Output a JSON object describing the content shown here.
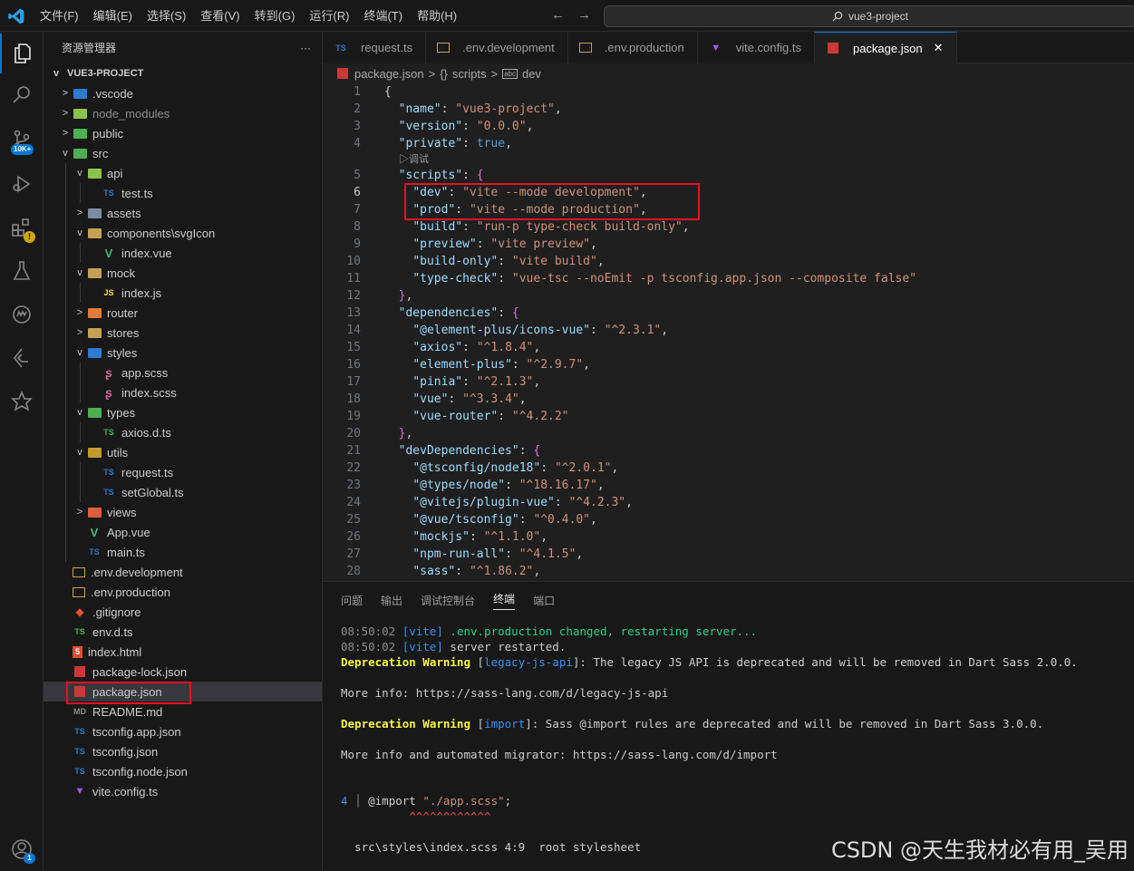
{
  "menu": [
    "文件(F)",
    "编辑(E)",
    "选择(S)",
    "查看(V)",
    "转到(G)",
    "运行(R)",
    "终端(T)",
    "帮助(H)"
  ],
  "command_center": "vue3-project",
  "activity": {
    "scm_badge": "10K+"
  },
  "explorer": {
    "title": "资源管理器",
    "more": "···",
    "project": "VUE3-PROJECT",
    "items": [
      {
        "label": ".vscode",
        "depth": 0,
        "chev": ">",
        "icon": "folder",
        "color": "#2f7ad2"
      },
      {
        "label": "node_modules",
        "depth": 0,
        "chev": ">",
        "icon": "folder",
        "color": "#8bc34a",
        "dim": true
      },
      {
        "label": "public",
        "depth": 0,
        "chev": ">",
        "icon": "folder",
        "color": "#4caf50"
      },
      {
        "label": "src",
        "depth": 0,
        "chev": "v",
        "icon": "folder",
        "color": "#4caf50"
      },
      {
        "label": "api",
        "depth": 1,
        "chev": "v",
        "icon": "folder",
        "color": "#8bc34a"
      },
      {
        "label": "test.ts",
        "depth": 2,
        "chev": "",
        "icon": "TS",
        "color": "#3178c6"
      },
      {
        "label": "assets",
        "depth": 1,
        "chev": ">",
        "icon": "folder",
        "color": "#7e8aa0"
      },
      {
        "label": "components\\svgIcon",
        "depth": 1,
        "chev": "v",
        "icon": "folder",
        "color": "#c5a155"
      },
      {
        "label": "index.vue",
        "depth": 2,
        "chev": "",
        "icon": "V",
        "color": "#41b883"
      },
      {
        "label": "mock",
        "depth": 1,
        "chev": "v",
        "icon": "folder",
        "color": "#c5a155"
      },
      {
        "label": "index.js",
        "depth": 2,
        "chev": "",
        "icon": "JS",
        "color": "#f1dd35"
      },
      {
        "label": "router",
        "depth": 1,
        "chev": ">",
        "icon": "folder",
        "color": "#e07b39"
      },
      {
        "label": "stores",
        "depth": 1,
        "chev": ">",
        "icon": "folder",
        "color": "#c5a155"
      },
      {
        "label": "styles",
        "depth": 1,
        "chev": "v",
        "icon": "folder",
        "color": "#2f7ad2"
      },
      {
        "label": "app.scss",
        "depth": 2,
        "chev": "",
        "icon": "S",
        "color": "#cd6799"
      },
      {
        "label": "index.scss",
        "depth": 2,
        "chev": "",
        "icon": "S",
        "color": "#cd6799"
      },
      {
        "label": "types",
        "depth": 1,
        "chev": "v",
        "icon": "folder",
        "color": "#4caf50"
      },
      {
        "label": "axios.d.ts",
        "depth": 2,
        "chev": "",
        "icon": "TS",
        "color": "#4caf50"
      },
      {
        "label": "utils",
        "depth": 1,
        "chev": "v",
        "icon": "folder",
        "color": "#c59a2c"
      },
      {
        "label": "request.ts",
        "depth": 2,
        "chev": "",
        "icon": "TS",
        "color": "#3178c6"
      },
      {
        "label": "setGlobal.ts",
        "depth": 2,
        "chev": "",
        "icon": "TS",
        "color": "#3178c6"
      },
      {
        "label": "views",
        "depth": 1,
        "chev": ">",
        "icon": "folder",
        "color": "#e05d3a"
      },
      {
        "label": "App.vue",
        "depth": 1,
        "chev": "",
        "icon": "V",
        "color": "#41b883"
      },
      {
        "label": "main.ts",
        "depth": 1,
        "chev": "",
        "icon": "TS",
        "color": "#3178c6"
      },
      {
        "label": ".env.development",
        "depth": 0,
        "chev": "",
        "icon": "env",
        "color": "#c5a155"
      },
      {
        "label": ".env.production",
        "depth": 0,
        "chev": "",
        "icon": "env",
        "color": "#c5a155"
      },
      {
        "label": ".gitignore",
        "depth": 0,
        "chev": "",
        "icon": "git",
        "color": "#e94e32"
      },
      {
        "label": "env.d.ts",
        "depth": 0,
        "chev": "",
        "icon": "TS",
        "color": "#4caf50"
      },
      {
        "label": "index.html",
        "depth": 0,
        "chev": "",
        "icon": "5",
        "color": "#e44d26"
      },
      {
        "label": "package-lock.json",
        "depth": 0,
        "chev": "",
        "icon": "npm",
        "color": "#cb3837"
      },
      {
        "label": "package.json",
        "depth": 0,
        "chev": "",
        "icon": "npm",
        "color": "#cb3837",
        "selected": true
      },
      {
        "label": "README.md",
        "depth": 0,
        "chev": "",
        "icon": "MD",
        "color": "#8a8a8a"
      },
      {
        "label": "tsconfig.app.json",
        "depth": 0,
        "chev": "",
        "icon": "TS",
        "color": "#3178c6"
      },
      {
        "label": "tsconfig.json",
        "depth": 0,
        "chev": "",
        "icon": "TS",
        "color": "#3178c6"
      },
      {
        "label": "tsconfig.node.json",
        "depth": 0,
        "chev": "",
        "icon": "TS",
        "color": "#3178c6"
      },
      {
        "label": "vite.config.ts",
        "depth": 0,
        "chev": "",
        "icon": "vite",
        "color": "#a855f7"
      }
    ]
  },
  "tabs": [
    {
      "label": "request.ts",
      "icon": "TS",
      "color": "#3178c6"
    },
    {
      "label": ".env.development",
      "icon": "env",
      "color": "#c5a155"
    },
    {
      "label": ".env.production",
      "icon": "env",
      "color": "#c5a155"
    },
    {
      "label": "vite.config.ts",
      "icon": "vite",
      "color": "#a855f7"
    },
    {
      "label": "package.json",
      "icon": "npm",
      "color": "#cb3837",
      "active": true,
      "close": "✕"
    }
  ],
  "breadcrumb": {
    "file": "package.json",
    "sep": ">",
    "scripts_icon": "{}",
    "scripts": "scripts",
    "dev_icon": "abc",
    "dev": "dev"
  },
  "code": {
    "lens": "▷调试",
    "lines": [
      {
        "n": "1",
        "t": [
          [
            "w",
            "{"
          ]
        ]
      },
      {
        "n": "2",
        "t": [
          [
            "w",
            "  "
          ],
          [
            "k",
            "\"name\""
          ],
          [
            "w",
            ": "
          ],
          [
            "s",
            "\"vue3-project\""
          ],
          [
            "w",
            ","
          ]
        ]
      },
      {
        "n": "3",
        "t": [
          [
            "w",
            "  "
          ],
          [
            "k",
            "\"version\""
          ],
          [
            "w",
            ": "
          ],
          [
            "s",
            "\"0.0.0\""
          ],
          [
            "w",
            ","
          ]
        ]
      },
      {
        "n": "4",
        "t": [
          [
            "w",
            "  "
          ],
          [
            "k",
            "\"private\""
          ],
          [
            "w",
            ": "
          ],
          [
            "b",
            "true"
          ],
          [
            "w",
            ","
          ]
        ]
      },
      {
        "n": "",
        "lens": true
      },
      {
        "n": "5",
        "t": [
          [
            "w",
            "  "
          ],
          [
            "k",
            "\"scripts\""
          ],
          [
            "w",
            ": "
          ],
          [
            "p",
            "{"
          ]
        ]
      },
      {
        "n": "6",
        "cur": true,
        "t": [
          [
            "w",
            "    "
          ],
          [
            "k",
            "\"dev\""
          ],
          [
            "w",
            ": "
          ],
          [
            "s",
            "\"vite --mode development\""
          ],
          [
            "w",
            ","
          ]
        ]
      },
      {
        "n": "7",
        "t": [
          [
            "w",
            "    "
          ],
          [
            "k",
            "\"prod\""
          ],
          [
            "w",
            ": "
          ],
          [
            "s",
            "\"vite --mode production\""
          ],
          [
            "w",
            ","
          ]
        ]
      },
      {
        "n": "8",
        "t": [
          [
            "w",
            "    "
          ],
          [
            "k",
            "\"build\""
          ],
          [
            "w",
            ": "
          ],
          [
            "s",
            "\"run-p type-check build-only\""
          ],
          [
            "w",
            ","
          ]
        ]
      },
      {
        "n": "9",
        "t": [
          [
            "w",
            "    "
          ],
          [
            "k",
            "\"preview\""
          ],
          [
            "w",
            ": "
          ],
          [
            "s",
            "\"vite preview\""
          ],
          [
            "w",
            ","
          ]
        ]
      },
      {
        "n": "10",
        "t": [
          [
            "w",
            "    "
          ],
          [
            "k",
            "\"build-only\""
          ],
          [
            "w",
            ": "
          ],
          [
            "s",
            "\"vite build\""
          ],
          [
            "w",
            ","
          ]
        ]
      },
      {
        "n": "11",
        "t": [
          [
            "w",
            "    "
          ],
          [
            "k",
            "\"type-check\""
          ],
          [
            "w",
            ": "
          ],
          [
            "s",
            "\"vue-tsc --noEmit -p tsconfig.app.json --composite false\""
          ]
        ]
      },
      {
        "n": "12",
        "t": [
          [
            "w",
            "  "
          ],
          [
            "p",
            "}"
          ],
          [
            "w",
            ","
          ]
        ]
      },
      {
        "n": "13",
        "t": [
          [
            "w",
            "  "
          ],
          [
            "k",
            "\"dependencies\""
          ],
          [
            "w",
            ": "
          ],
          [
            "p",
            "{"
          ]
        ]
      },
      {
        "n": "14",
        "t": [
          [
            "w",
            "    "
          ],
          [
            "k",
            "\"@element-plus/icons-vue\""
          ],
          [
            "w",
            ": "
          ],
          [
            "s",
            "\"^2.3.1\""
          ],
          [
            "w",
            ","
          ]
        ]
      },
      {
        "n": "15",
        "t": [
          [
            "w",
            "    "
          ],
          [
            "k",
            "\"axios\""
          ],
          [
            "w",
            ": "
          ],
          [
            "s",
            "\"^1.8.4\""
          ],
          [
            "w",
            ","
          ]
        ]
      },
      {
        "n": "16",
        "t": [
          [
            "w",
            "    "
          ],
          [
            "k",
            "\"element-plus\""
          ],
          [
            "w",
            ": "
          ],
          [
            "s",
            "\"^2.9.7\""
          ],
          [
            "w",
            ","
          ]
        ]
      },
      {
        "n": "17",
        "t": [
          [
            "w",
            "    "
          ],
          [
            "k",
            "\"pinia\""
          ],
          [
            "w",
            ": "
          ],
          [
            "s",
            "\"^2.1.3\""
          ],
          [
            "w",
            ","
          ]
        ]
      },
      {
        "n": "18",
        "t": [
          [
            "w",
            "    "
          ],
          [
            "k",
            "\"vue\""
          ],
          [
            "w",
            ": "
          ],
          [
            "s",
            "\"^3.3.4\""
          ],
          [
            "w",
            ","
          ]
        ]
      },
      {
        "n": "19",
        "t": [
          [
            "w",
            "    "
          ],
          [
            "k",
            "\"vue-router\""
          ],
          [
            "w",
            ": "
          ],
          [
            "s",
            "\"^4.2.2\""
          ]
        ]
      },
      {
        "n": "20",
        "t": [
          [
            "w",
            "  "
          ],
          [
            "p",
            "}"
          ],
          [
            "w",
            ","
          ]
        ]
      },
      {
        "n": "21",
        "t": [
          [
            "w",
            "  "
          ],
          [
            "k",
            "\"devDependencies\""
          ],
          [
            "w",
            ": "
          ],
          [
            "p",
            "{"
          ]
        ]
      },
      {
        "n": "22",
        "t": [
          [
            "w",
            "    "
          ],
          [
            "k",
            "\"@tsconfig/node18\""
          ],
          [
            "w",
            ": "
          ],
          [
            "s",
            "\"^2.0.1\""
          ],
          [
            "w",
            ","
          ]
        ]
      },
      {
        "n": "23",
        "t": [
          [
            "w",
            "    "
          ],
          [
            "k",
            "\"@types/node\""
          ],
          [
            "w",
            ": "
          ],
          [
            "s",
            "\"^18.16.17\""
          ],
          [
            "w",
            ","
          ]
        ]
      },
      {
        "n": "24",
        "t": [
          [
            "w",
            "    "
          ],
          [
            "k",
            "\"@vitejs/plugin-vue\""
          ],
          [
            "w",
            ": "
          ],
          [
            "s",
            "\"^4.2.3\""
          ],
          [
            "w",
            ","
          ]
        ]
      },
      {
        "n": "25",
        "t": [
          [
            "w",
            "    "
          ],
          [
            "k",
            "\"@vue/tsconfig\""
          ],
          [
            "w",
            ": "
          ],
          [
            "s",
            "\"^0.4.0\""
          ],
          [
            "w",
            ","
          ]
        ]
      },
      {
        "n": "26",
        "t": [
          [
            "w",
            "    "
          ],
          [
            "k",
            "\"mockjs\""
          ],
          [
            "w",
            ": "
          ],
          [
            "s",
            "\"^1.1.0\""
          ],
          [
            "w",
            ","
          ]
        ]
      },
      {
        "n": "27",
        "t": [
          [
            "w",
            "    "
          ],
          [
            "k",
            "\"npm-run-all\""
          ],
          [
            "w",
            ": "
          ],
          [
            "s",
            "\"^4.1.5\""
          ],
          [
            "w",
            ","
          ]
        ]
      },
      {
        "n": "28",
        "t": [
          [
            "w",
            "    "
          ],
          [
            "k",
            "\"sass\""
          ],
          [
            "w",
            ": "
          ],
          [
            "s",
            "\"^1.86.2\""
          ],
          [
            "w",
            ","
          ]
        ]
      }
    ]
  },
  "panel": {
    "tabs": [
      {
        "label": "问题"
      },
      {
        "label": "输出"
      },
      {
        "label": "调试控制台"
      },
      {
        "label": "终端",
        "active": true
      },
      {
        "label": "端口"
      }
    ],
    "lines": [
      [
        [
          "gy",
          "08:50:02 "
        ],
        [
          "cy",
          "[vite]"
        ],
        [
          "gr",
          " .env.production changed, restarting server..."
        ]
      ],
      [
        [
          "gy",
          "08:50:02 "
        ],
        [
          "cy",
          "[vite]"
        ],
        [
          "w",
          " server restarted."
        ]
      ],
      [
        [
          "yb",
          "Deprecation Warning"
        ],
        [
          "w",
          " ["
        ],
        [
          "bl",
          "legacy-js-api"
        ],
        [
          "w",
          "]: The legacy JS API is deprecated and will be removed in Dart Sass 2.0.0."
        ]
      ],
      [],
      [
        [
          "w",
          "More info: https://sass-lang.com/d/legacy-js-api"
        ]
      ],
      [],
      [
        [
          "yb",
          "Deprecation Warning"
        ],
        [
          "w",
          " ["
        ],
        [
          "bl",
          "import"
        ],
        [
          "w",
          "]: Sass @import rules are deprecated and will be removed in Dart Sass 3.0.0."
        ]
      ],
      [],
      [
        [
          "w",
          "More info and automated migrator: https://sass-lang.com/d/import"
        ]
      ],
      [],
      [],
      [
        [
          "cy",
          "4 "
        ],
        [
          "gy",
          "│ "
        ],
        [
          "w",
          "@import "
        ],
        [
          "s",
          "\"./app.scss\""
        ],
        [
          "w",
          ";"
        ]
      ],
      [
        [
          "w",
          "          "
        ],
        [
          "rs",
          "^^^^^^^^^^^^"
        ]
      ],
      [],
      [
        [
          "w",
          "  src\\styles\\index.scss 4:9  root stylesheet"
        ]
      ]
    ]
  },
  "watermark": "CSDN @天生我材必有用_吴用"
}
